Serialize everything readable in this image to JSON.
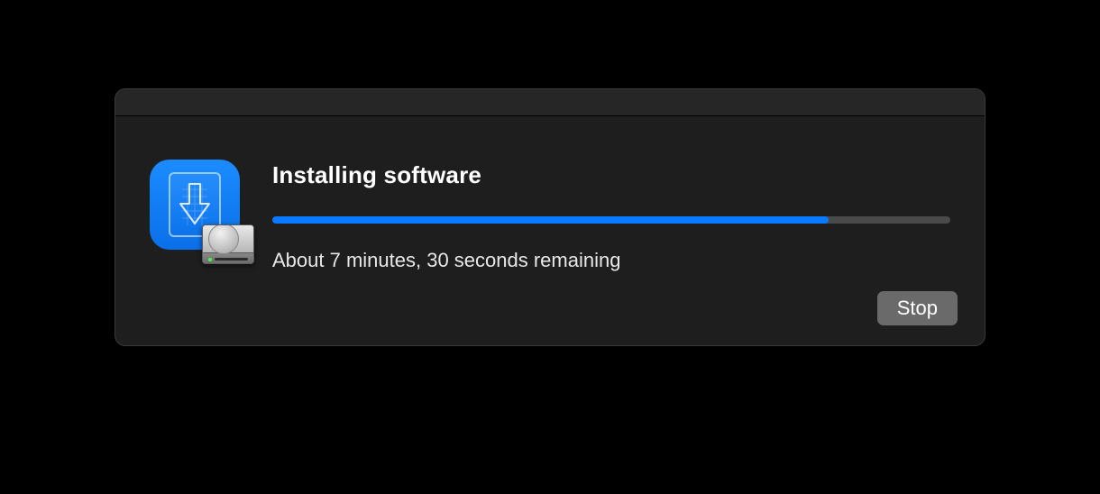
{
  "dialog": {
    "title": "Installing software",
    "status": "About 7 minutes, 30 seconds remaining",
    "progress_percent": 82,
    "stop_label": "Stop"
  },
  "icons": {
    "app": "installer-icon",
    "disk": "hard-disk-icon"
  },
  "colors": {
    "progress_fill": "#0a7aff",
    "progress_track": "#4a4a4a",
    "dialog_bg": "#1e1e1e"
  }
}
